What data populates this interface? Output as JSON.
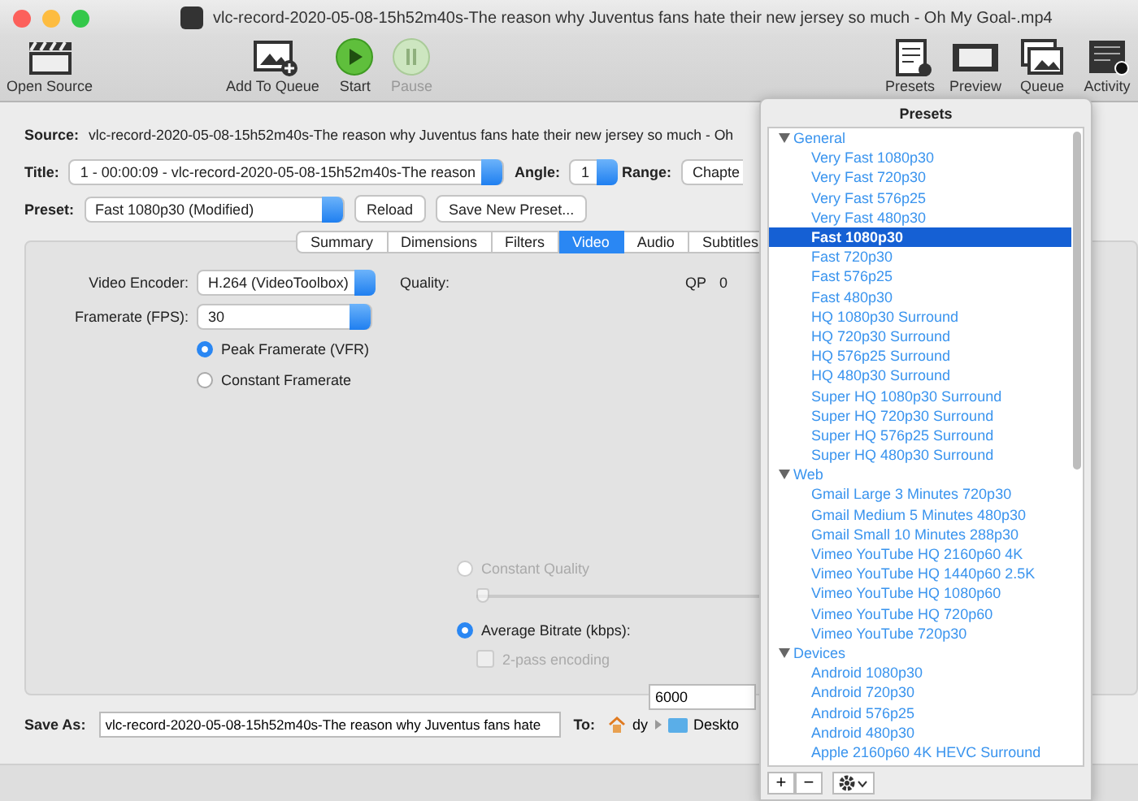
{
  "window": {
    "title": "vlc-record-2020-05-08-15h52m40s-The reason why Juventus fans hate their new jersey so much - Oh My Goal-.mp4"
  },
  "toolbar": {
    "left": [
      {
        "kind": "open",
        "label": "Open Source",
        "disabled": false
      },
      {
        "kind": "add",
        "label": "Add To Queue",
        "disabled": false
      },
      {
        "kind": "start",
        "label": "Start",
        "disabled": false
      },
      {
        "kind": "pause",
        "label": "Pause",
        "disabled": true
      }
    ],
    "right": [
      {
        "kind": "presets",
        "label": "Presets"
      },
      {
        "kind": "preview",
        "label": "Preview"
      },
      {
        "kind": "queue",
        "label": "Queue"
      },
      {
        "kind": "activity",
        "label": "Activity"
      }
    ]
  },
  "source": {
    "label": "Source:",
    "value": "vlc-record-2020-05-08-15h52m40s-The reason why Juventus fans hate their new jersey so much - Oh"
  },
  "title_row": {
    "label": "Title:",
    "value": "1 - 00:00:09 - vlc-record-2020-05-08-15h52m40s-The reason",
    "angle_label": "Angle:",
    "angle": "1",
    "range_label": "Range:",
    "range": "Chapte"
  },
  "preset_row": {
    "label": "Preset:",
    "value": "Fast 1080p30 (Modified)",
    "buttons": [
      "Reload",
      "Save New Preset..."
    ]
  },
  "tabs": [
    {
      "label": "Summary",
      "selected": false
    },
    {
      "label": "Dimensions",
      "selected": false
    },
    {
      "label": "Filters",
      "selected": false
    },
    {
      "label": "Video",
      "selected": true
    },
    {
      "label": "Audio",
      "selected": false
    },
    {
      "label": "Subtitles",
      "selected": false
    }
  ],
  "video": {
    "encoder_label": "Video Encoder:",
    "encoder": "H.264 (VideoToolbox)",
    "framerate_label": "Framerate (FPS):",
    "framerate": "30",
    "framerate_modes": [
      {
        "label": "Peak Framerate (VFR)",
        "selected": true
      },
      {
        "label": "Constant Framerate",
        "selected": false
      }
    ],
    "quality_label": "Quality:",
    "qp_label": "QP",
    "qp": "0",
    "quality_modes": [
      {
        "label": "Constant Quality",
        "selected": false,
        "disabled": true
      },
      {
        "label": "Average Bitrate (kbps):",
        "selected": true,
        "disabled": false
      }
    ],
    "quality_slider": {
      "level": 0.0,
      "disabled": true
    },
    "two_pass": {
      "label": "2-pass encoding",
      "checked": false,
      "disabled": true
    },
    "bitrate": "6000"
  },
  "save_as": {
    "label": "Save As:",
    "value": "vlc-record-2020-05-08-15h52m40s-The reason why Juventus fans hate",
    "to_label": "To:",
    "path": [
      "dy",
      "Deskto"
    ]
  },
  "presets_popover": {
    "title": "Presets",
    "groups": [
      {
        "label": "General",
        "expanded": true,
        "children": [
          {
            "label": "Very Fast 1080p30",
            "selected": false
          },
          {
            "label": "Very Fast 720p30",
            "selected": false
          },
          {
            "label": "Very Fast 576p25",
            "selected": false
          },
          {
            "label": "Very Fast 480p30",
            "selected": false
          },
          {
            "label": "Fast 1080p30",
            "selected": true
          },
          {
            "label": "Fast 720p30",
            "selected": false
          },
          {
            "label": "Fast 576p25",
            "selected": false
          },
          {
            "label": "Fast 480p30",
            "selected": false
          },
          {
            "label": "HQ 1080p30 Surround",
            "selected": false
          },
          {
            "label": "HQ 720p30 Surround",
            "selected": false
          },
          {
            "label": "HQ 576p25 Surround",
            "selected": false
          },
          {
            "label": "HQ 480p30 Surround",
            "selected": false
          },
          {
            "label": "Super HQ 1080p30 Surround",
            "selected": false
          },
          {
            "label": "Super HQ 720p30 Surround",
            "selected": false
          },
          {
            "label": "Super HQ 576p25 Surround",
            "selected": false
          },
          {
            "label": "Super HQ 480p30 Surround",
            "selected": false
          }
        ]
      },
      {
        "label": "Web",
        "expanded": true,
        "children": [
          {
            "label": "Gmail Large 3 Minutes 720p30",
            "selected": false
          },
          {
            "label": "Gmail Medium 5 Minutes 480p30",
            "selected": false
          },
          {
            "label": "Gmail Small 10 Minutes 288p30",
            "selected": false
          },
          {
            "label": "Vimeo YouTube HQ 2160p60 4K",
            "selected": false
          },
          {
            "label": "Vimeo YouTube HQ 1440p60 2.5K",
            "selected": false
          },
          {
            "label": "Vimeo YouTube HQ 1080p60",
            "selected": false
          },
          {
            "label": "Vimeo YouTube HQ 720p60",
            "selected": false
          },
          {
            "label": "Vimeo YouTube 720p30",
            "selected": false
          }
        ]
      },
      {
        "label": "Devices",
        "expanded": true,
        "children": [
          {
            "label": "Android 1080p30",
            "selected": false
          },
          {
            "label": "Android 720p30",
            "selected": false
          },
          {
            "label": "Android 576p25",
            "selected": false
          },
          {
            "label": "Android 480p30",
            "selected": false
          },
          {
            "label": "Apple 2160p60 4K HEVC Surround",
            "selected": false
          }
        ]
      }
    ],
    "buttons": [
      "+",
      "−"
    ]
  }
}
